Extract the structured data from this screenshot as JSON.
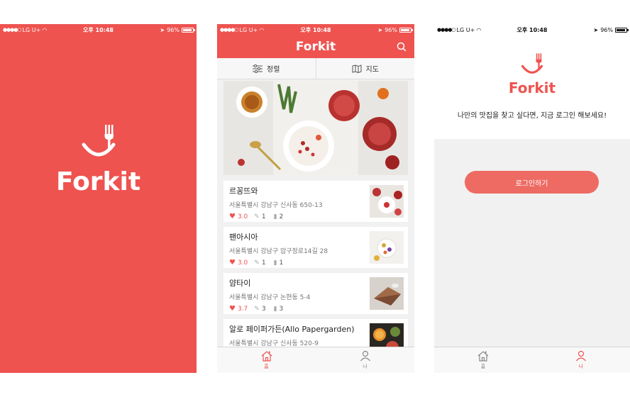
{
  "colors": {
    "brand": "#ee5350",
    "button": "#ee6b63",
    "muted": "#777777"
  },
  "status_bar": {
    "carrier": "LG U+",
    "time": "오후 10:48",
    "battery": "96%",
    "battery_level": 0.96
  },
  "splash": {
    "logo_text": "Forkit"
  },
  "home": {
    "title": "Forkit",
    "sort_label": "정렬",
    "map_label": "지도",
    "restaurants": [
      {
        "name": "르꽁뜨와",
        "address": "서울특별시 강남구 신사동 650-13",
        "rating": "3.0",
        "reviews": "1",
        "bookmarks": "2"
      },
      {
        "name": "팬아시아",
        "address": "서울특별시 강남구 압구정로14길 28",
        "rating": "3.0",
        "reviews": "1",
        "bookmarks": "1"
      },
      {
        "name": "얌타이",
        "address": "서울특별시 강남구 논현동 5-4",
        "rating": "3.7",
        "reviews": "3",
        "bookmarks": "3"
      },
      {
        "name": "알로 페이퍼가든(Allo Papergarden)",
        "address": "서울특별시 강남구 신사동 520-9"
      }
    ]
  },
  "tabs": {
    "home": "홈",
    "me": "나"
  },
  "login": {
    "logo_text": "Forkit",
    "message": "나만의 맛집을 찾고 싶다면, 지금 로그인 해보세요!",
    "button_label": "로그인하기"
  }
}
